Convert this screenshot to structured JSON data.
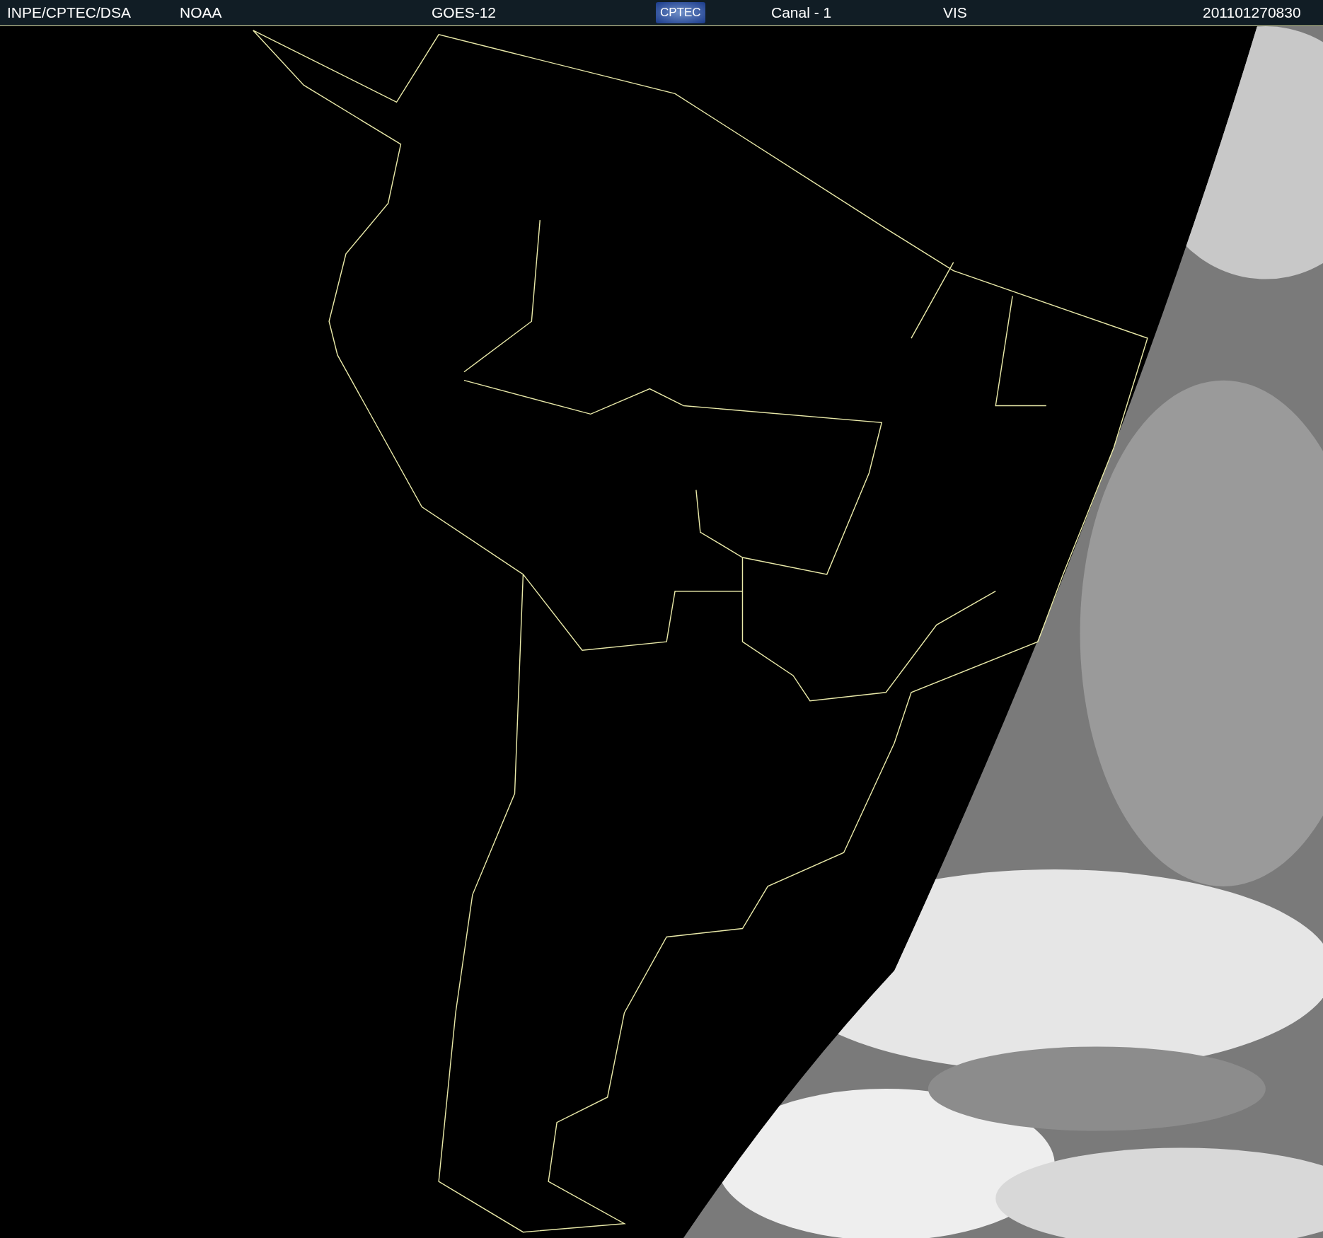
{
  "header": {
    "items": [
      {
        "kind": "text",
        "text": "INPE/CPTEC/DSA"
      },
      {
        "kind": "text",
        "text": "NOAA"
      },
      {
        "kind": "text",
        "text": "GOES-12"
      },
      {
        "kind": "logo",
        "text": "CPTEC"
      },
      {
        "kind": "text",
        "text": "Canal - 1"
      },
      {
        "kind": "text",
        "text": "VIS"
      },
      {
        "kind": "text",
        "text": "201101270830"
      }
    ]
  }
}
